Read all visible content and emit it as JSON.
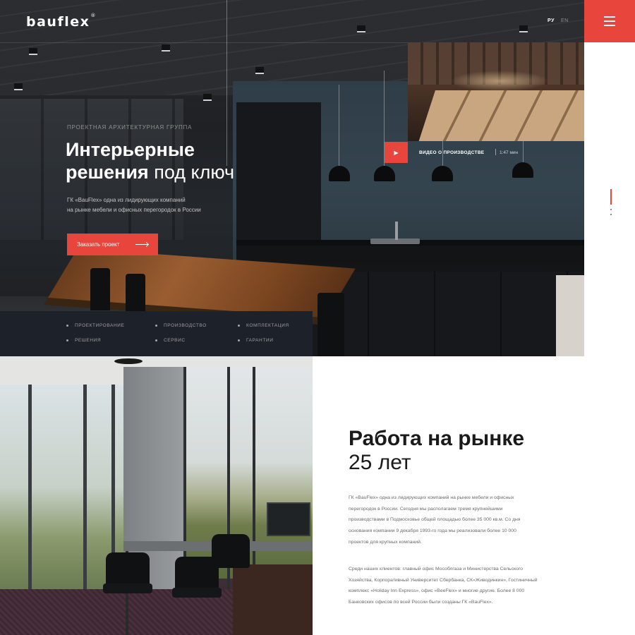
{
  "header": {
    "logo": "bauflex",
    "logo_mark": "®",
    "lang_active": "РУ",
    "lang_other": "EN",
    "menu_icon": "hamburger-icon",
    "accent_color": "#e8453c"
  },
  "hero": {
    "eyebrow": "Проектная архитектурная группа",
    "title_bold_1": "Интерьерные",
    "title_bold_2": "решения",
    "title_light": " под ключ",
    "desc_line_1": "ГК «BauFlex» одна из лидирующих компаний",
    "desc_line_2": "на рынке мебели и офисных перегородок в России",
    "cta_label": "Заказать проект",
    "video_label": "Видео о производстве",
    "video_duration": "1:47 мин",
    "play_icon": "play-icon"
  },
  "services": [
    "Проектирование",
    "Производство",
    "Комплектация",
    "Решения",
    "Сервис",
    "Гарантии"
  ],
  "about": {
    "title": "Работа на рынке",
    "subtitle": "25 лет",
    "p1_lines": [
      "ГК «BauFlex» одна из лидирующих компаний на рынке мебели и офисных",
      "перегородок в России. Сегодня мы располагаем тремя крупнейшими",
      "производствами в Подмосковье общей площадью более 35 000 кв.м. Со дня",
      "основания компании 9 декабря 1993-го года мы реализовали более 10 000",
      "проектов для крупных компаний."
    ],
    "p2_lines": [
      "Среди наших клиентов: главный офис Мособлгаза и Министерства Сельского",
      "Хозяйства, Корпоративный Университет Сбербанка, СК«Живодинкин», Гостиничный",
      "комплекс «Holiday Inn Express», офис «BeeFlex» и многие другие. Более 8 000",
      "Банковских офисов по всей России были созданы ГК «BauFlex»."
    ]
  }
}
